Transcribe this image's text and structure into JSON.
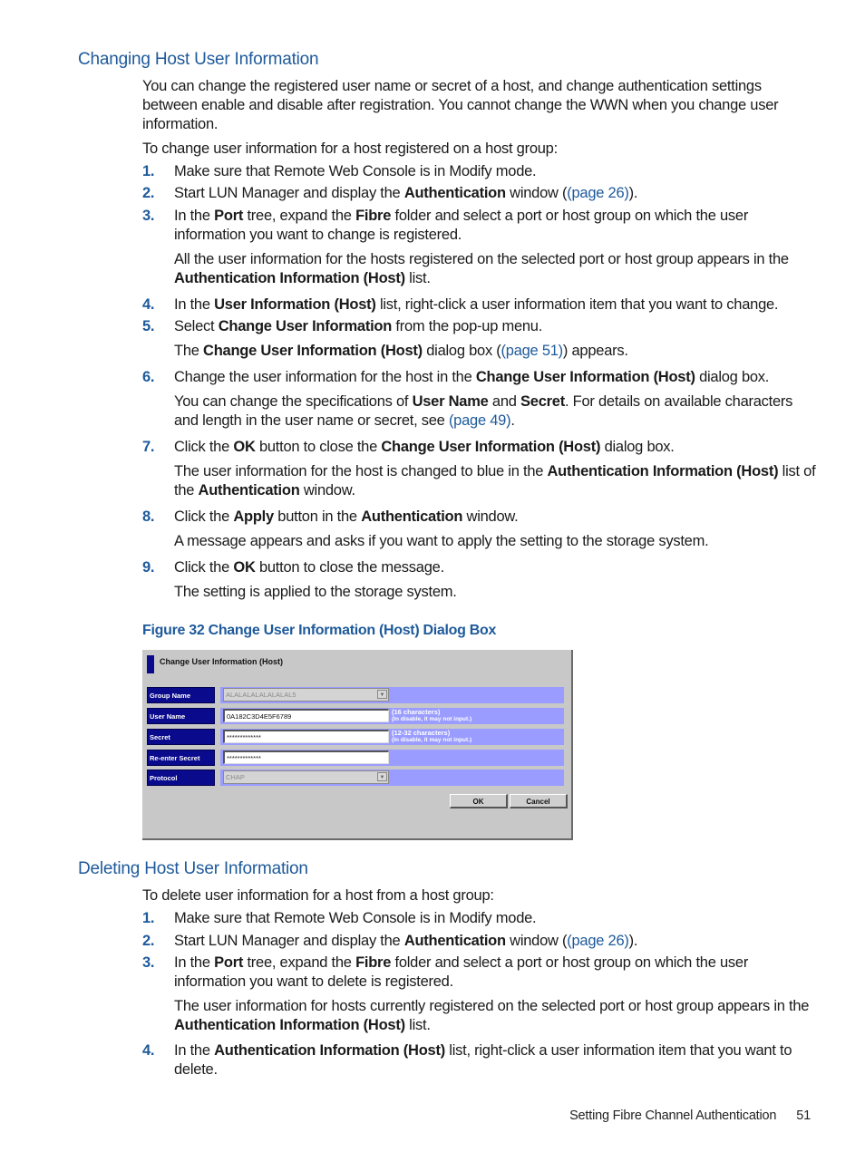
{
  "section1": {
    "heading": "Changing Host User Information",
    "intro": "You can change the registered user name or secret of a host, and change authentication settings between enable and disable after registration. You cannot change the WWN when you change user information.",
    "lead": "To change user information for a host registered on a host group:",
    "steps": [
      {
        "num": "1.",
        "parts": [
          "Make sure that Remote Web Console is in Modify mode."
        ]
      },
      {
        "num": "2.",
        "a": "Start LUN Manager and display the ",
        "b": "Authentication",
        "c": " window (",
        "link": "(page 26)",
        "d": ")."
      },
      {
        "num": "3.",
        "a": "In the ",
        "b": "Port",
        "c": " tree, expand the ",
        "d": "Fibre",
        "e": " folder and select a port or host group on which the user information you want to change is registered.",
        "sub_a": "All the user information for the hosts registered on the selected port or host group appears in the ",
        "sub_b": "Authentication Information (Host)",
        "sub_c": " list."
      },
      {
        "num": "4.",
        "a": "In the ",
        "b": "User Information (Host)",
        "c": " list, right-click a user information item that you want to change."
      },
      {
        "num": "5.",
        "a": "Select ",
        "b": "Change User Information",
        "c": " from the pop-up menu.",
        "sub_a": "The ",
        "sub_b": "Change User Information (Host)",
        "sub_c": " dialog box (",
        "sub_link": "(page 51)",
        "sub_d": ") appears."
      },
      {
        "num": "6.",
        "a": "Change the user information for the host in the ",
        "b": "Change User Information (Host)",
        "c": " dialog box.",
        "sub_a": "You can change the specifications of ",
        "sub_b": "User Name",
        "sub_c": " and ",
        "sub_d": "Secret",
        "sub_e": ". For details on available characters and length in the user name or secret, see ",
        "sub_link": "(page 49)",
        "sub_f": "."
      },
      {
        "num": "7.",
        "a": "Click the ",
        "b": "OK",
        "c": " button to close the ",
        "d": "Change User Information (Host)",
        "e": " dialog box.",
        "sub_a": "The user information for the host is changed to blue in the ",
        "sub_b": "Authentication Information (Host)",
        "sub_c": " list of the ",
        "sub_d": "Authentication",
        "sub_e": " window."
      },
      {
        "num": "8.",
        "a": "Click the ",
        "b": "Apply",
        "c": " button in the ",
        "d": "Authentication",
        "e": " window.",
        "sub": "A message appears and asks if you want to apply the setting to the storage system."
      },
      {
        "num": "9.",
        "a": "Click the ",
        "b": "OK",
        "c": " button to close the message.",
        "sub": "The setting is applied to the storage system."
      }
    ]
  },
  "figure": {
    "caption": "Figure 32 Change User Information (Host) Dialog Box",
    "dialog": {
      "title": "Change User Information (Host)",
      "rows": [
        {
          "label": "Group Name",
          "value": "ALALALALALALALAL5",
          "type": "combo",
          "hint1": "",
          "hint2": ""
        },
        {
          "label": "User Name",
          "value": "0A182C3D4E5F6789",
          "type": "text",
          "hint1": "(16 characters)",
          "hint2": "(In disable, it may not input.)"
        },
        {
          "label": "Secret",
          "value": "*************",
          "type": "text",
          "hint1": "(12-32 characters)",
          "hint2": "(In disable, it may not input.)"
        },
        {
          "label": "Re-enter Secret",
          "value": "*************",
          "type": "text",
          "hint1": "",
          "hint2": ""
        },
        {
          "label": "Protocol",
          "value": "CHAP",
          "type": "combo",
          "hint1": "",
          "hint2": ""
        }
      ],
      "ok_label": "OK",
      "cancel_label": "Cancel",
      "dropdown_arrow": "▼"
    }
  },
  "section2": {
    "heading": "Deleting Host User Information",
    "lead": "To delete user information for a host from a host group:",
    "steps": [
      {
        "num": "1.",
        "a": "Make sure that Remote Web Console is in Modify mode."
      },
      {
        "num": "2.",
        "a": "Start LUN Manager and display the ",
        "b": "Authentication",
        "c": " window (",
        "link": "(page 26)",
        "d": ")."
      },
      {
        "num": "3.",
        "a": "In the ",
        "b": "Port",
        "c": " tree, expand the ",
        "d": "Fibre",
        "e": " folder and select a port or host group on which the user information you want to delete is registered.",
        "sub_a": "The user information for hosts currently registered on the selected port or host group appears in the ",
        "sub_b": "Authentication Information (Host)",
        "sub_c": " list."
      },
      {
        "num": "4.",
        "a": "In the ",
        "b": "Authentication Information (Host)",
        "c": " list, right-click a user information item that you want to delete."
      }
    ]
  },
  "footer": {
    "title": "Setting Fibre Channel Authentication",
    "page": "51"
  },
  "colors": {
    "heading": "#1e5a9a",
    "dialog_label_bg": "#0a0a8c",
    "dialog_band": "#9a9cff",
    "dialog_bg": "#c8c8c8"
  }
}
